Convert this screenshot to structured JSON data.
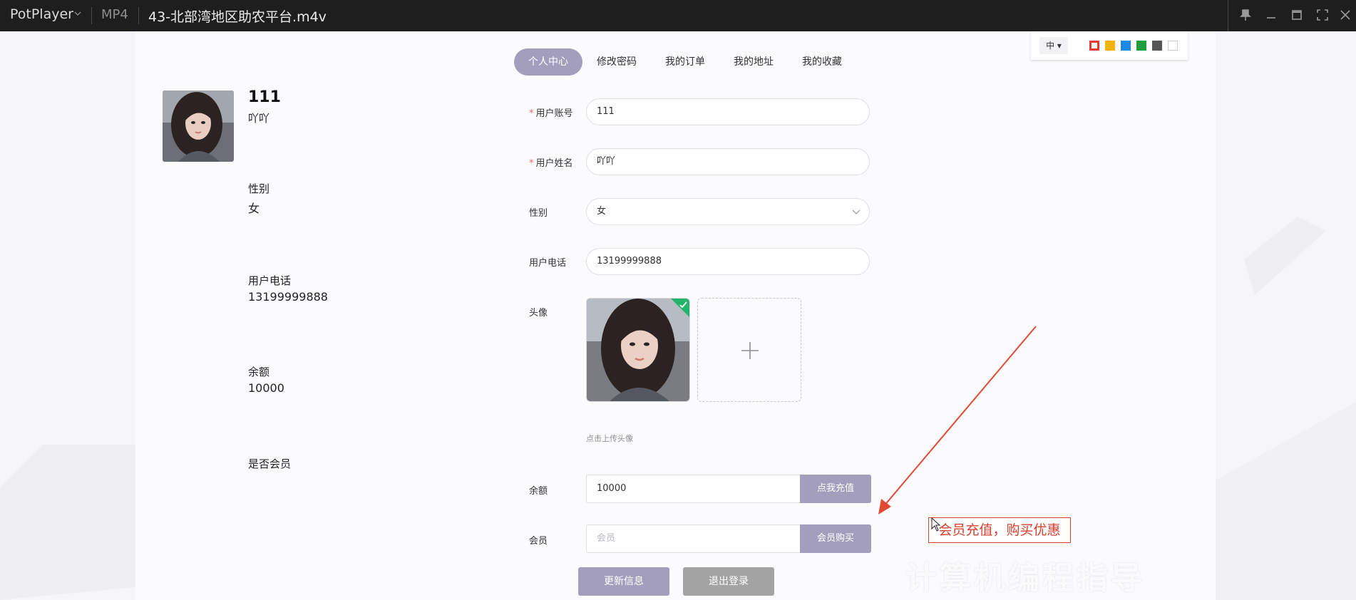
{
  "window": {
    "app_name": "PotPlayer",
    "format": "MP4",
    "file_title": "43-北部湾地区助农平台.m4v"
  },
  "tabs": [
    {
      "label": "个人中心",
      "active": true
    },
    {
      "label": "修改密码",
      "active": false
    },
    {
      "label": "我的订单",
      "active": false
    },
    {
      "label": "我的地址",
      "active": false
    },
    {
      "label": "我的收藏",
      "active": false
    }
  ],
  "profile": {
    "username": "111",
    "name": "吖吖",
    "gender_label": "性别",
    "gender_value": "女",
    "phone_label": "用户电话",
    "phone_value": "13199999888",
    "balance_label": "余额",
    "balance_value": "10000",
    "member_label": "是否会员"
  },
  "form": {
    "account_label": "用户账号",
    "account_value": "111",
    "name_label": "用户姓名",
    "name_value": "吖吖",
    "gender_label": "性别",
    "gender_value": "女",
    "phone_label": "用户电话",
    "phone_value": "13199999888",
    "avatar_label": "头像",
    "upload_tip": "点击上传头像",
    "balance_label": "余额",
    "balance_value": "10000",
    "recharge_button": "点我充值",
    "member_label": "会员",
    "member_placeholder": "会员",
    "member_buy_button": "会员购买",
    "update_button": "更新信息",
    "logout_button": "退出登录"
  },
  "annotation": {
    "size_label": "中",
    "colors": [
      "#e53935",
      "#f4b400",
      "#1e88e5",
      "#1e9e3a",
      "#555555",
      "#ffffff"
    ],
    "note_text": "会员充值，购买优惠",
    "arrow_color": "#e04a33"
  },
  "watermark_text": "计算机编程指导"
}
